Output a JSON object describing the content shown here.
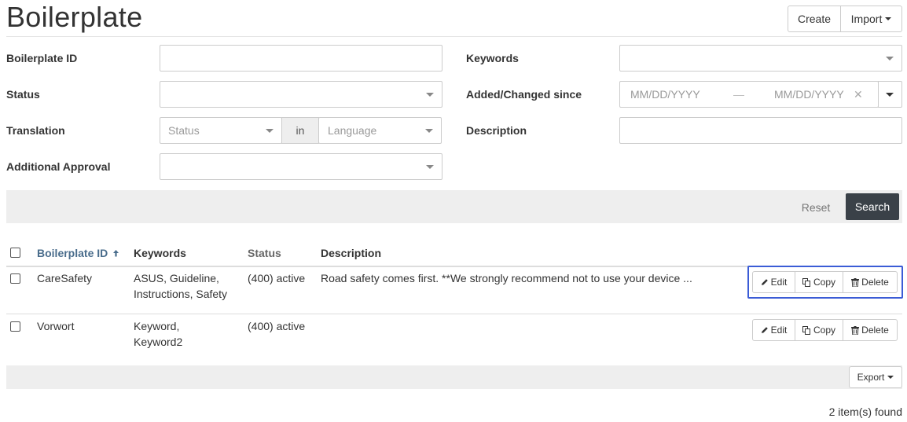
{
  "header": {
    "title": "Boilerplate",
    "create_label": "Create",
    "import_label": "Import"
  },
  "filters": {
    "boilerplate_id_label": "Boilerplate ID",
    "status_label": "Status",
    "translation_label": "Translation",
    "translation_status_placeholder": "Status",
    "translation_in_label": "in",
    "translation_language_placeholder": "Language",
    "additional_approval_label": "Additional Approval",
    "keywords_label": "Keywords",
    "added_changed_label": "Added/Changed since",
    "date_from_placeholder": "MM/DD/YYYY",
    "date_separator": "—",
    "date_to_placeholder": "MM/DD/YYYY",
    "date_clear": "✕",
    "description_label": "Description"
  },
  "search_bar": {
    "reset_label": "Reset",
    "search_label": "Search"
  },
  "table": {
    "columns": [
      "Boilerplate ID",
      "Keywords",
      "Status",
      "Description"
    ],
    "rows": [
      {
        "id": "CareSafety",
        "keywords_line1": "ASUS, Guideline,",
        "keywords_line2": "Instructions, Safety",
        "status": "(400) active",
        "description": "Road safety comes first. **We strongly recommend not to use your device ..."
      },
      {
        "id": "Vorwort",
        "keywords_line1": "Keyword,",
        "keywords_line2": "Keyword2",
        "status": "(400) active",
        "description": ""
      }
    ],
    "actions": {
      "edit": "Edit",
      "copy": "Copy",
      "delete": "Delete"
    }
  },
  "footer": {
    "export_label": "Export",
    "found_text": "2 item(s) found"
  },
  "colors": {
    "search_button": "#3a4148",
    "highlight_border": "#3b5cd6",
    "sort_header": "#4a6d8c"
  }
}
